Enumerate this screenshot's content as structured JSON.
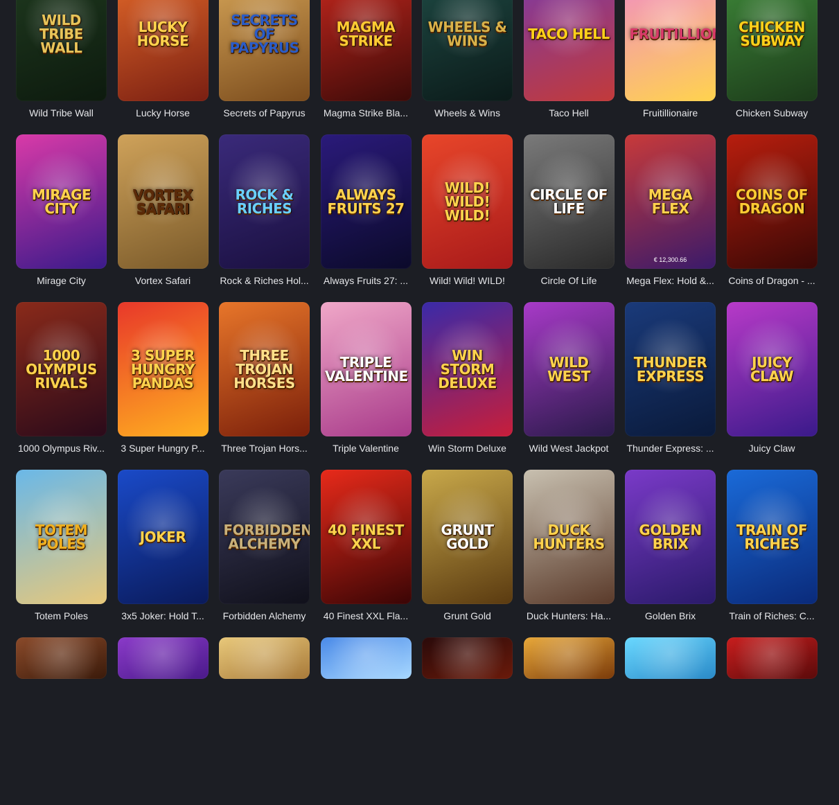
{
  "games": [
    {
      "title": "Wild Tribe Wall",
      "logo": "Wild Tribe Wall",
      "bg": [
        "#1f3a1f",
        "#0d1a0e"
      ],
      "accent": "#e8c45a"
    },
    {
      "title": "Lucky Horse",
      "logo": "Lucky Horse",
      "bg": [
        "#e56a2a",
        "#7a1f12"
      ],
      "accent": "#ffd34d"
    },
    {
      "title": "Secrets of Papyrus",
      "logo": "Secrets of Papyrus",
      "bg": [
        "#d9a85a",
        "#7a4b1c"
      ],
      "accent": "#2a5cc8"
    },
    {
      "title": "Magma Strike Bla...",
      "logo": "Magma Strike",
      "bg": [
        "#c9281e",
        "#3b0a08"
      ],
      "accent": "#ffcc33"
    },
    {
      "title": "Wheels & Wins",
      "logo": "Wheels & Wins",
      "bg": [
        "#1f4b45",
        "#0b1a19"
      ],
      "accent": "#d9b24a"
    },
    {
      "title": "Taco Hell",
      "logo": "Taco Hell",
      "bg": [
        "#7a3aa8",
        "#c23a3a"
      ],
      "accent": "#ffd11a"
    },
    {
      "title": "Fruitillionaire",
      "logo": "Fruitillionaire",
      "bg": [
        "#f08acb",
        "#ffd34d"
      ],
      "accent": "#d93a6a"
    },
    {
      "title": "Chicken Subway",
      "logo": "Chicken Subway",
      "bg": [
        "#3f8a3a",
        "#1c3b1a"
      ],
      "accent": "#ffd11a"
    },
    {
      "title": "Mirage City",
      "logo": "Mirage City",
      "bg": [
        "#d93aa8",
        "#3a1a8a"
      ],
      "accent": "#ffd34d"
    },
    {
      "title": "Vortex Safari",
      "logo": "Vortex Safari",
      "bg": [
        "#cfa25a",
        "#7a5a2a"
      ],
      "accent": "#5a2a0a"
    },
    {
      "title": "Rock & Riches Hol...",
      "logo": "Rock & Riches",
      "bg": [
        "#3a2a7a",
        "#1a1040"
      ],
      "accent": "#6ad0ff"
    },
    {
      "title": "Always Fruits 27: ...",
      "logo": "Always Fruits 27",
      "bg": [
        "#2a1a7a",
        "#0b0a2a"
      ],
      "accent": "#ffd34d"
    },
    {
      "title": "Wild! Wild! WILD!",
      "logo": "Wild! Wild! Wild!",
      "bg": [
        "#e8462a",
        "#a81a1a"
      ],
      "accent": "#ffd34d"
    },
    {
      "title": "Circle Of Life",
      "logo": "Circle of Life",
      "bg": [
        "#7a7a7a",
        "#2a2a2a"
      ],
      "accent": "#ffffff"
    },
    {
      "title": "Mega Flex: Hold &...",
      "logo": "Mega Flex",
      "bg": [
        "#c83a3a",
        "#3a1a6a"
      ],
      "accent": "#ffd34d",
      "sub": "€ 12,300.66"
    },
    {
      "title": "Coins of Dragon - ...",
      "logo": "Coins of Dragon",
      "bg": [
        "#b81e0e",
        "#3a0805"
      ],
      "accent": "#ffcc33"
    },
    {
      "title": "1000 Olympus Riv...",
      "logo": "1000 Olympus Rivals",
      "bg": [
        "#8a2a1a",
        "#2a0a1a"
      ],
      "accent": "#ffd34d"
    },
    {
      "title": "3 Super Hungry P...",
      "logo": "3 Super Hungry Pandas",
      "bg": [
        "#e8382a",
        "#ffb020"
      ],
      "accent": "#ffd34d"
    },
    {
      "title": "Three Trojan Hors...",
      "logo": "Three Trojan Horses",
      "bg": [
        "#e8762a",
        "#7a1f0a"
      ],
      "accent": "#ffe08a"
    },
    {
      "title": "Triple Valentine",
      "logo": "Triple Valentine",
      "bg": [
        "#f0a8c8",
        "#a83a8a"
      ],
      "accent": "#ffffff"
    },
    {
      "title": "Win Storm Deluxe",
      "logo": "Win Storm Deluxe",
      "bg": [
        "#3a2aa8",
        "#c81e3a"
      ],
      "accent": "#ffd34d"
    },
    {
      "title": "Wild West Jackpot",
      "logo": "Wild West",
      "bg": [
        "#a83ac8",
        "#2a1a4a"
      ],
      "accent": "#ffd34d"
    },
    {
      "title": "Thunder Express: ...",
      "logo": "Thunder Express",
      "bg": [
        "#1a3a7a",
        "#0a1a3a"
      ],
      "accent": "#ffd34d"
    },
    {
      "title": "Juicy Claw",
      "logo": "Juicy Claw",
      "bg": [
        "#b83ac8",
        "#3a1a8a"
      ],
      "accent": "#ffd34d"
    },
    {
      "title": "Totem Poles",
      "logo": "Totem Poles",
      "bg": [
        "#6ab8e8",
        "#e8c87a"
      ],
      "accent": "#f0b020"
    },
    {
      "title": "3x5 Joker: Hold T...",
      "logo": "Joker",
      "bg": [
        "#1a4ac8",
        "#0a1a5a"
      ],
      "accent": "#ffd34d"
    },
    {
      "title": "Forbidden Alchemy",
      "logo": "Forbidden Alchemy",
      "bg": [
        "#3a3a5a",
        "#10101a"
      ],
      "accent": "#c8b07a"
    },
    {
      "title": "40 Finest XXL Fla...",
      "logo": "40 Finest XXL",
      "bg": [
        "#e82a1a",
        "#3a0505"
      ],
      "accent": "#ffd34d"
    },
    {
      "title": "Grunt Gold",
      "logo": "Grunt Gold",
      "bg": [
        "#c8a84a",
        "#5a3a10"
      ],
      "accent": "#ffffff"
    },
    {
      "title": "Duck Hunters: Ha...",
      "logo": "Duck Hunters",
      "bg": [
        "#c8c0b0",
        "#5a3a2a"
      ],
      "accent": "#ffd34d"
    },
    {
      "title": "Golden Brix",
      "logo": "Golden Brix",
      "bg": [
        "#7a3ac8",
        "#2a1a6a"
      ],
      "accent": "#ffd34d"
    },
    {
      "title": "Train of Riches: C...",
      "logo": "Train of Riches",
      "bg": [
        "#1a6ad8",
        "#0a2a7a"
      ],
      "accent": "#ffd34d"
    },
    {
      "title": "",
      "logo": "",
      "bg": [
        "#8a4a2a",
        "#3a1a0a"
      ],
      "accent": "#ffd34d"
    },
    {
      "title": "",
      "logo": "",
      "bg": [
        "#8a3ac8",
        "#4a1a8a"
      ],
      "accent": "#ffd34d"
    },
    {
      "title": "",
      "logo": "",
      "bg": [
        "#e8c87a",
        "#a87a3a"
      ],
      "accent": "#ffd34d"
    },
    {
      "title": "",
      "logo": "",
      "bg": [
        "#4a8ae8",
        "#a8d8ff"
      ],
      "accent": "#e82a1a"
    },
    {
      "title": "",
      "logo": "",
      "bg": [
        "#2a0a0a",
        "#6a1a0a"
      ],
      "accent": "#ffd34d"
    },
    {
      "title": "",
      "logo": "",
      "bg": [
        "#e8a83a",
        "#7a3a0a"
      ],
      "accent": "#ffd34d"
    },
    {
      "title": "",
      "logo": "",
      "bg": [
        "#6ad8ff",
        "#2a8ac8"
      ],
      "accent": "#ffd34d"
    },
    {
      "title": "",
      "logo": "",
      "bg": [
        "#c81e1e",
        "#5a0a0a"
      ],
      "accent": "#ffd34d"
    }
  ]
}
